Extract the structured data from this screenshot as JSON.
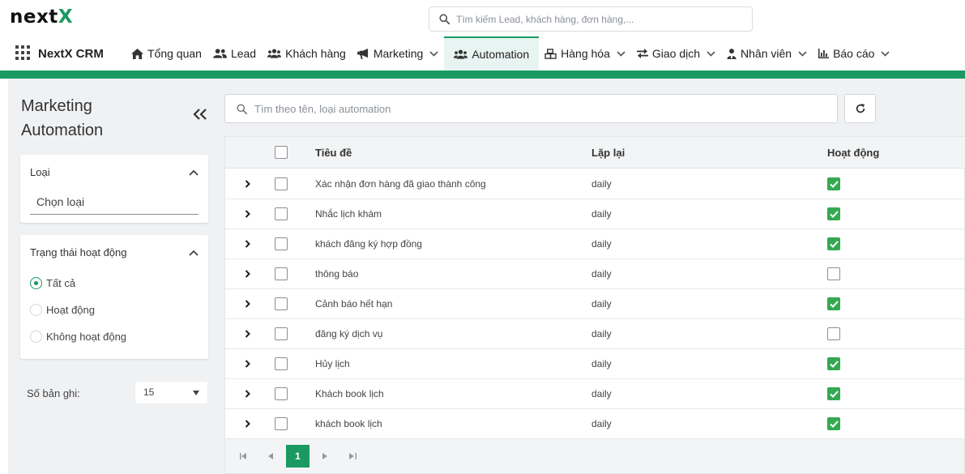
{
  "header": {
    "logo_main": "next",
    "logo_accent": "X",
    "search_placeholder": "Tìm kiếm Lead, khách hàng, đơn hàng,..."
  },
  "navbar": {
    "brand": "NextX CRM",
    "items": [
      {
        "label": "Tổng quan",
        "icon": "home-icon"
      },
      {
        "label": "Lead",
        "icon": "users-icon"
      },
      {
        "label": "Khách hàng",
        "icon": "user-group-icon"
      },
      {
        "label": "Marketing",
        "icon": "megaphone-icon",
        "has_dropdown": true
      },
      {
        "label": "Automation",
        "icon": "automation-icon",
        "active": true
      },
      {
        "label": "Hàng hóa",
        "icon": "cubes-icon",
        "has_dropdown": true
      },
      {
        "label": "Giao dịch",
        "icon": "exchange-icon",
        "has_dropdown": true
      },
      {
        "label": "Nhân viên",
        "icon": "user-tie-icon",
        "has_dropdown": true
      },
      {
        "label": "Báo cáo",
        "icon": "chart-icon",
        "has_dropdown": true
      }
    ]
  },
  "sidebar": {
    "title_line1": "Marketing",
    "title_line2": "Automation",
    "type_filter": {
      "label": "Loại",
      "placeholder": "Chọn loại"
    },
    "status_filter": {
      "label": "Trạng thái hoạt động",
      "options": [
        "Tất cả",
        "Hoạt động",
        "Không hoạt động"
      ],
      "selected": "Tất cả"
    },
    "records_label": "Số bản ghi:",
    "records_value": "15"
  },
  "main": {
    "search_placeholder": "Tìm theo tên, loại automation",
    "columns": {
      "title": "Tiêu đề",
      "repeat": "Lặp lại",
      "active": "Hoạt động"
    },
    "rows": [
      {
        "title": "Xác nhận đơn hàng đã giao thành công",
        "repeat": "daily",
        "active": true
      },
      {
        "title": "Nhắc lịch khám",
        "repeat": "daily",
        "active": true
      },
      {
        "title": "khách đăng ký hợp đồng",
        "repeat": "daily",
        "active": true
      },
      {
        "title": "thông báo",
        "repeat": "daily",
        "active": false
      },
      {
        "title": "Cảnh báo hết hạn",
        "repeat": "daily",
        "active": true
      },
      {
        "title": "đăng ký dịch vụ",
        "repeat": "daily",
        "active": false
      },
      {
        "title": "Hủy lịch",
        "repeat": "daily",
        "active": true
      },
      {
        "title": "Khách book lịch",
        "repeat": "daily",
        "active": true
      },
      {
        "title": "khách book lịch",
        "repeat": "daily",
        "active": true
      }
    ],
    "pagination": {
      "current_page": "1"
    }
  },
  "colors": {
    "accent": "#1a9a62",
    "checkbox_on": "#35a852"
  }
}
